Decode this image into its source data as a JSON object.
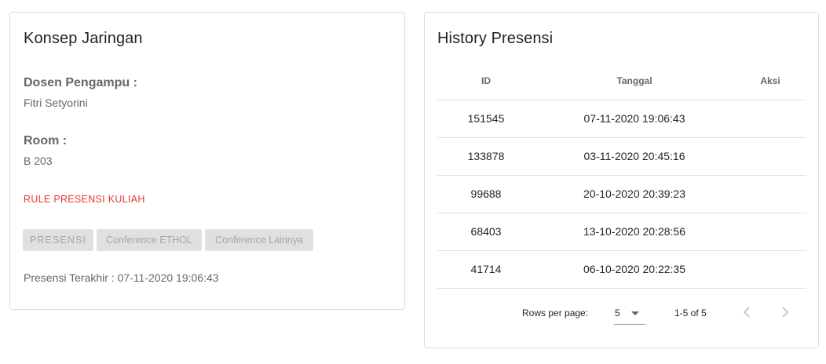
{
  "course": {
    "title": "Konsep Jaringan",
    "dosen_label": "Dosen Pengampu :",
    "dosen_value": "Fitri Setyorini",
    "room_label": "Room :",
    "room_value": "B 203",
    "rule_link": "RULE PRESENSI KULIAH",
    "buttons": {
      "presensi": "PRESENSI",
      "conference_ethol": "Conference ETHOL",
      "conference_lainnya": "Conference Lainnya"
    },
    "last_presensi": "Presensi Terakhir : 07-11-2020 19:06:43"
  },
  "history": {
    "title": "History Presensi",
    "columns": {
      "id": "ID",
      "tanggal": "Tanggal",
      "aksi": "Aksi"
    },
    "rows": [
      {
        "id": "151545",
        "tanggal": "07-11-2020 19:06:43"
      },
      {
        "id": "133878",
        "tanggal": "03-11-2020 20:45:16"
      },
      {
        "id": "99688",
        "tanggal": "20-10-2020 20:39:23"
      },
      {
        "id": "68403",
        "tanggal": "13-10-2020 20:28:56"
      },
      {
        "id": "41714",
        "tanggal": "06-10-2020 20:22:35"
      }
    ],
    "footer": {
      "rows_per_page_label": "Rows per page:",
      "rows_per_page_value": "5",
      "range": "1-5 of 5"
    }
  },
  "icons": {
    "prev": "chevron-left-icon",
    "next": "chevron-right-icon",
    "dropdown": "caret-down-icon"
  },
  "colors": {
    "rule_link": "#e53935",
    "button_bg": "#e0e0e0",
    "button_text": "#a6a6a6"
  }
}
